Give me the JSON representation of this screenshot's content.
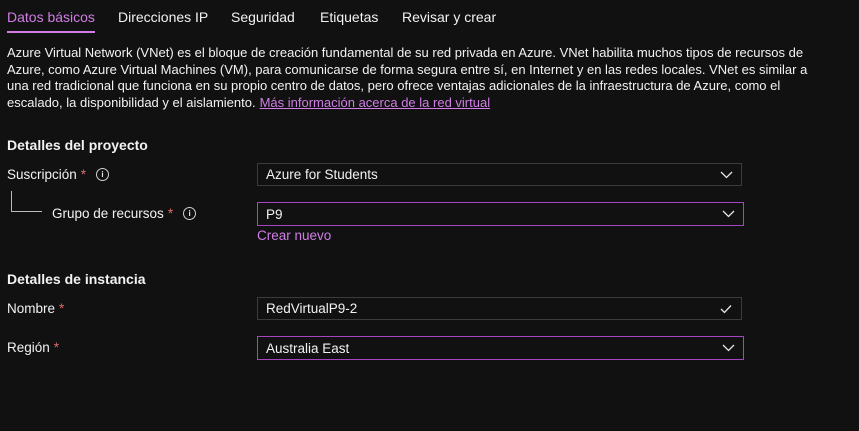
{
  "tabs": [
    {
      "label": "Datos básicos",
      "active": true
    },
    {
      "label": "Direcciones IP"
    },
    {
      "label": "Seguridad"
    },
    {
      "label": "Etiquetas"
    },
    {
      "label": "Revisar y crear"
    }
  ],
  "description": {
    "text": "Azure Virtual Network (VNet) es el bloque de creación fundamental de su red privada en Azure. VNet habilita muchos tipos de recursos de Azure, como Azure Virtual Machines (VM), para comunicarse de forma segura entre sí, en Internet y en las redes locales. VNet es similar a una red tradicional que funciona en su propio centro de datos, pero ofrece ventajas adicionales de la infraestructura de Azure, como el escalado, la disponibilidad y el aislamiento.",
    "link": "Más información acerca de la red virtual"
  },
  "project": {
    "title": "Detalles del proyecto",
    "subscription_label": "Suscripción",
    "subscription_value": "Azure for Students",
    "resource_group_label": "Grupo de recursos",
    "resource_group_value": "P9",
    "create_new": "Crear nuevo"
  },
  "instance": {
    "title": "Detalles de instancia",
    "name_label": "Nombre",
    "name_value": "RedVirtualP9-2",
    "region_label": "Región",
    "region_value": "Australia East"
  },
  "required_marker": "*",
  "colors": {
    "accent": "#d07ee6",
    "required": "#e06b6b",
    "background": "#111111",
    "focus_border": "#a645c4"
  }
}
